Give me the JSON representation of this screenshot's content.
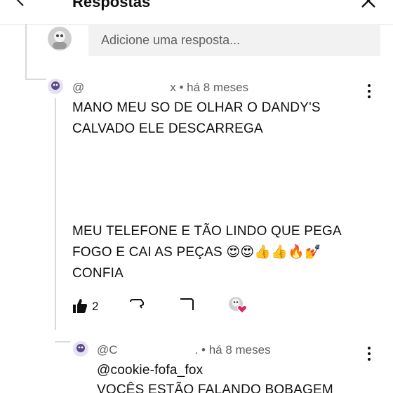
{
  "header": {
    "title": "Respostas",
    "back_icon": "arrow-left-icon",
    "close_icon": "close-icon"
  },
  "reply_box": {
    "placeholder": "Adicione uma resposta..."
  },
  "comments": [
    {
      "handle_prefix": "@",
      "handle_suffix": "x",
      "time": "• há 8 meses",
      "lines": [
        "MANO MEU SO DE OLHAR O DANDY'S",
        "CALVADO ELE DESCARREGA",
        "",
        "",
        "",
        "MEU TELEFONE E TÃO LINDO QUE PEGA",
        "FOGO E CAI AS PEÇAS 😍😍👍👍🔥💅",
        "CONFIA"
      ],
      "like_count": "2",
      "icons": [
        "thumbs-up-icon",
        "thumbs-down-icon",
        "comment-icon",
        "creator-heart-icon"
      ]
    },
    {
      "handle_prefix": "@C",
      "handle_suffix": ".",
      "time": "• há 8 meses",
      "lines": [
        "@cookie-fofa_fox",
        "VOCÊS ESTÃO FALANDO BOBAGEM"
      ]
    }
  ],
  "colors": {
    "text_primary": "#0f0f0f",
    "text_secondary": "#606060",
    "input_bg": "#f2f2f2",
    "thread_line": "#d9d9d9",
    "heart": "#e0245e"
  }
}
